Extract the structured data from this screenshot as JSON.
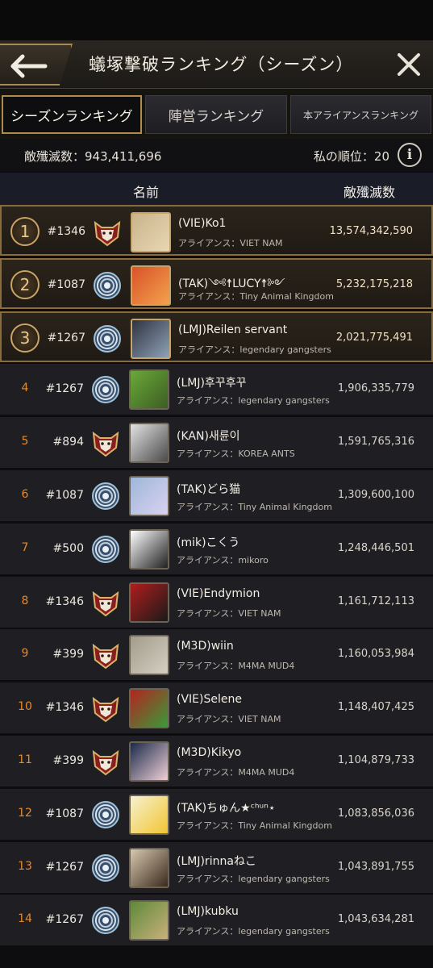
{
  "header": {
    "title": "蟻塚撃破ランキング（シーズン）"
  },
  "tabs": [
    {
      "label": "シーズンランキング",
      "active": true
    },
    {
      "label": "陣営ランキング",
      "active": false
    },
    {
      "label": "本アライアンスランキング",
      "active": false
    }
  ],
  "stats": {
    "kills_text": "敵殲滅数：943,411,696",
    "my_rank_text": "私の順位：20"
  },
  "columns": {
    "name": "名前",
    "score": "敵殲滅数"
  },
  "colors": {
    "accent_gold": "#b08b4e",
    "rank_orange": "#e58a2c",
    "row_bg": "#1f1f23"
  },
  "rows": [
    {
      "rank": "1",
      "server": "#1346",
      "emblem": "fox-emblem",
      "avatar": "player-avatar",
      "name": "(VIE)Ko1",
      "alliance": "アライアンス：VIET NAM",
      "score": "13,574,342,590"
    },
    {
      "rank": "2",
      "server": "#1087",
      "emblem": "shell-emblem",
      "avatar": "player-avatar",
      "name": "(TAK)༺☨LUCY☨༻",
      "alliance": "アライアンス：Tiny Animal Kingdom",
      "score": "5,232,175,218"
    },
    {
      "rank": "3",
      "server": "#1267",
      "emblem": "shell-emblem",
      "avatar": "player-avatar",
      "name": "(LMJ)Reilen servant",
      "alliance": "アライアンス：legendary gangsters",
      "score": "2,021,775,491"
    },
    {
      "rank": "4",
      "server": "#1267",
      "emblem": "shell-emblem",
      "avatar": "player-avatar",
      "name": "(LMJ)후꾸후꾸",
      "alliance": "アライアンス：legendary gangsters",
      "score": "1,906,335,779"
    },
    {
      "rank": "5",
      "server": "#894",
      "emblem": "fox-emblem",
      "avatar": "player-avatar",
      "name": "(KAN)새륜이",
      "alliance": "アライアンス：KOREA ANTS",
      "score": "1,591,765,316"
    },
    {
      "rank": "6",
      "server": "#1087",
      "emblem": "shell-emblem",
      "avatar": "player-avatar",
      "name": "(TAK)どら猫",
      "alliance": "アライアンス：Tiny Animal Kingdom",
      "score": "1,309,600,100"
    },
    {
      "rank": "7",
      "server": "#500",
      "emblem": "shell-emblem",
      "avatar": "player-avatar",
      "name": "(mik)こくう",
      "alliance": "アライアンス：mikoro",
      "score": "1,248,446,501"
    },
    {
      "rank": "8",
      "server": "#1346",
      "emblem": "fox-emblem",
      "avatar": "player-avatar",
      "name": "(VIE)Endymion",
      "alliance": "アライアンス：VIET NAM",
      "score": "1,161,712,113"
    },
    {
      "rank": "9",
      "server": "#399",
      "emblem": "fox-emblem",
      "avatar": "player-avatar",
      "name": "(M3D)wiin",
      "alliance": "アライアンス：M4MA MUD4",
      "score": "1,160,053,984"
    },
    {
      "rank": "10",
      "server": "#1346",
      "emblem": "fox-emblem",
      "avatar": "player-avatar",
      "name": "(VIE)Selene",
      "alliance": "アライアンス：VIET NAM",
      "score": "1,148,407,425"
    },
    {
      "rank": "11",
      "server": "#399",
      "emblem": "fox-emblem",
      "avatar": "player-avatar",
      "name": "(M3D)Kikyo",
      "alliance": "アライアンス：M4MA MUD4",
      "score": "1,104,879,733"
    },
    {
      "rank": "12",
      "server": "#1087",
      "emblem": "shell-emblem",
      "avatar": "player-avatar",
      "name": "(TAK)ちゅん★ᶜʰᵘⁿ⋆",
      "alliance": "アライアンス：Tiny Animal Kingdom",
      "score": "1,083,856,036"
    },
    {
      "rank": "13",
      "server": "#1267",
      "emblem": "shell-emblem",
      "avatar": "player-avatar",
      "name": "(LMJ)rinnaねこ",
      "alliance": "アライアンス：legendary gangsters",
      "score": "1,043,891,755"
    },
    {
      "rank": "14",
      "server": "#1267",
      "emblem": "shell-emblem",
      "avatar": "player-avatar",
      "name": "(LMJ)kubku",
      "alliance": "アライアンス：legendary gangsters",
      "score": "1,043,634,281"
    }
  ]
}
